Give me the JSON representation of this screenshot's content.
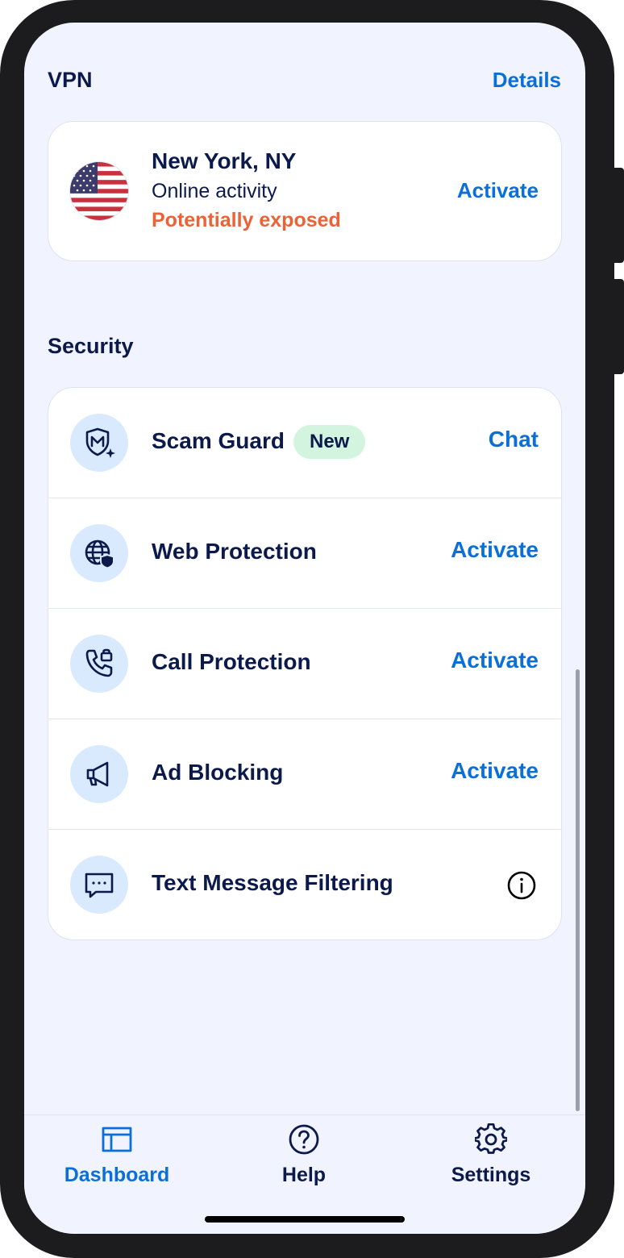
{
  "colors": {
    "accent": "#0a6fd8",
    "text": "#0c1a4b",
    "warning": "#ec6236",
    "badge_bg": "#d3f5e0",
    "icon_bg": "#d9eaff",
    "background": "#f1f4ff"
  },
  "vpn": {
    "title": "VPN",
    "details_label": "Details",
    "location": "New York, NY",
    "subtitle": "Online activity",
    "status": "Potentially exposed",
    "action_label": "Activate",
    "flag_icon": "us-flag-icon"
  },
  "security": {
    "title": "Security",
    "items": [
      {
        "label": "Scam Guard",
        "badge": "New",
        "action": "Chat",
        "icon": "shield-sparkle-icon"
      },
      {
        "label": "Web Protection",
        "action": "Activate",
        "icon": "globe-shield-icon"
      },
      {
        "label": "Call Protection",
        "action": "Activate",
        "icon": "phone-lock-icon"
      },
      {
        "label": "Ad Blocking",
        "action": "Activate",
        "icon": "megaphone-icon"
      },
      {
        "label": "Text Message Filtering",
        "action_icon": "info-icon",
        "icon": "message-icon"
      }
    ]
  },
  "nav": {
    "items": [
      {
        "label": "Dashboard",
        "icon": "dashboard-icon",
        "active": true
      },
      {
        "label": "Help",
        "icon": "help-icon"
      },
      {
        "label": "Settings",
        "icon": "gear-icon"
      }
    ]
  }
}
